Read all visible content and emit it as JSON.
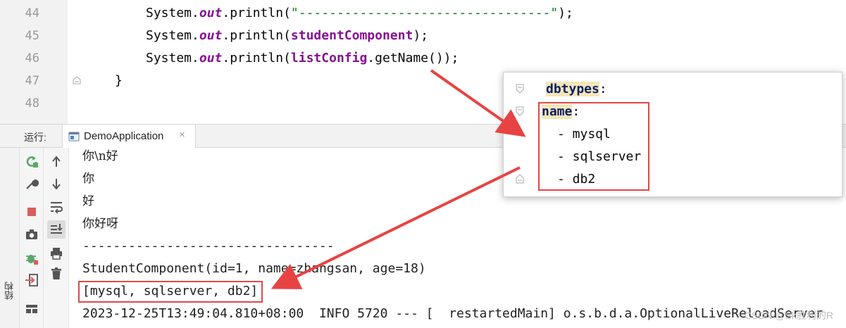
{
  "editor": {
    "lines": [
      {
        "num": "44",
        "prefix": "System.",
        "field": "out",
        "mid": ".println(",
        "str": "\"---------------------------------\"",
        "arg": "",
        "suffix": ");"
      },
      {
        "num": "45",
        "prefix": "System.",
        "field": "out",
        "mid": ".println(",
        "str": "",
        "arg": "studentComponent",
        "suffix": ");"
      },
      {
        "num": "46",
        "prefix": "System.",
        "field": "out",
        "mid": ".println(",
        "str": "",
        "arg": "listConfig",
        "suffix": ".getName());"
      },
      {
        "num": "47",
        "brace": "}"
      },
      {
        "num": "48"
      }
    ]
  },
  "run_panel": {
    "label": "运行:",
    "tab_label": "DemoApplication",
    "tab_close": "×"
  },
  "structure_label": "结构",
  "console_lines": [
    "你\\n好",
    "你",
    "好",
    "你好呀",
    "---------------------------------",
    "StudentComponent(id=1, name=zhangsan, age=18)",
    "[mysql, sqlserver, db2]",
    "2023-12-25T13:49:04.810+08:00  INFO 5720 --- [  restartedMain] o.s.b.d.a.OptionalLiveReloadServer"
  ],
  "watermark": "CSDN @Sk胜利的R",
  "yaml_popup": {
    "root_key": "dbtypes",
    "root_colon": ":",
    "child_key": "name",
    "child_colon": ":",
    "items": [
      "- mysql",
      "- sqlserver",
      "- db2"
    ]
  },
  "colors": {
    "highlight": "#e04848",
    "arrow": "#e84343",
    "string": "#067d17",
    "field": "#871094",
    "yaml_key": "#0b1f6b",
    "yaml_key_bg": "#f5e6b8"
  },
  "icons": {
    "run_tools": [
      "rerun-icon",
      "wrench-icon",
      "stop-icon",
      "camera-icon",
      "debug-icon",
      "login-icon",
      "layout-icon"
    ],
    "console_tools": [
      "up-arrow-icon",
      "down-arrow-icon",
      "soft-wrap-icon",
      "scroll-to-end-icon",
      "print-icon",
      "trash-icon"
    ]
  }
}
